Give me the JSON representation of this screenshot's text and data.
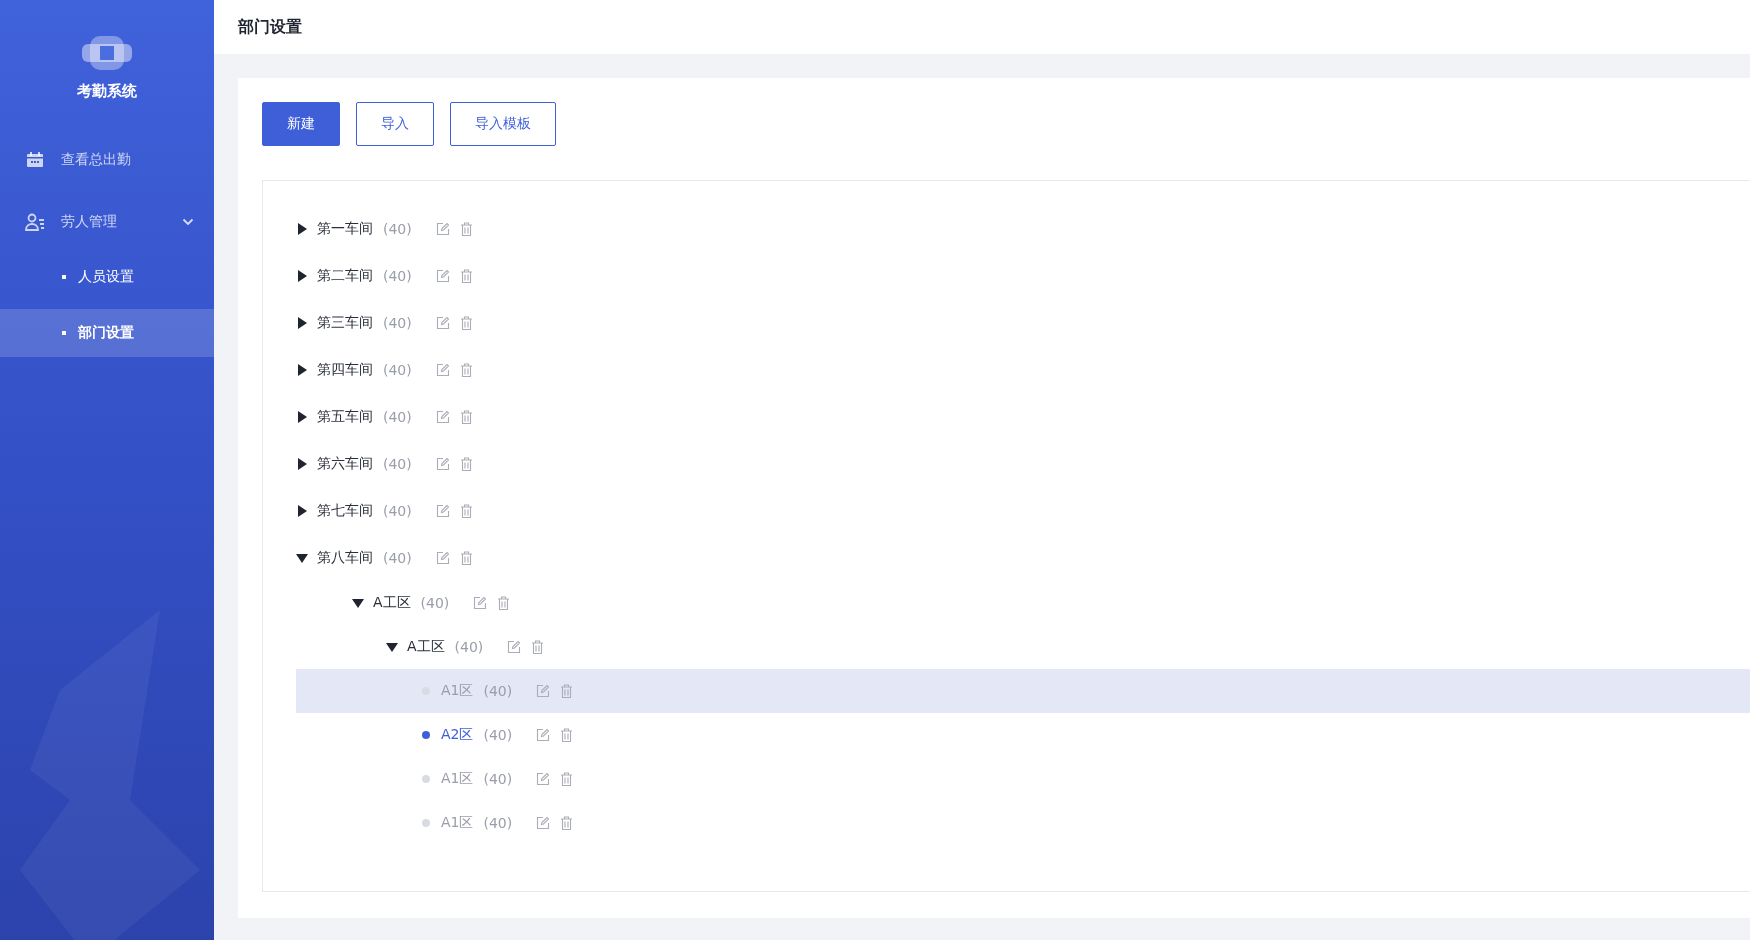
{
  "sidebar": {
    "app_name": "考勤系统",
    "menu": [
      {
        "label": "查看总出勤",
        "kind": "calendar"
      },
      {
        "label": "劳人管理",
        "kind": "people",
        "expanded": true,
        "children": [
          {
            "label": "人员设置",
            "selected": false
          },
          {
            "label": "部门设置",
            "selected": true
          }
        ]
      }
    ]
  },
  "header": {
    "title": "部门设置"
  },
  "buttons": [
    {
      "label": "新建",
      "kind": "primary"
    },
    {
      "label": "导入",
      "kind": "outline"
    },
    {
      "label": "导入模板",
      "kind": "outline"
    }
  ],
  "tree": [
    {
      "label": "第一车间",
      "count": "(40)",
      "expanded": false
    },
    {
      "label": "第二车间",
      "count": "(40)",
      "expanded": false
    },
    {
      "label": "第三车间",
      "count": "(40)",
      "expanded": false
    },
    {
      "label": "第四车间",
      "count": "(40)",
      "expanded": false
    },
    {
      "label": "第五车间",
      "count": "(40)",
      "expanded": false
    },
    {
      "label": "第六车间",
      "count": "(40)",
      "expanded": false
    },
    {
      "label": "第七车间",
      "count": "(40)",
      "expanded": false
    },
    {
      "label": "第八车间",
      "count": "(40)",
      "expanded": true,
      "children": [
        {
          "label": "A工区",
          "count": "(40)",
          "expanded": true,
          "children": [
            {
              "label": "A工区",
              "count": "(40)",
              "expanded": true,
              "children": [
                {
                  "label": "A1区",
                  "count": "(40)",
                  "kind": "leaf",
                  "selected": false,
                  "hovered": true
                },
                {
                  "label": "A2区",
                  "count": "(40)",
                  "kind": "leaf",
                  "selected": true,
                  "hovered": false
                },
                {
                  "label": "A1区",
                  "count": "(40)",
                  "kind": "leaf",
                  "selected": false,
                  "hovered": false
                },
                {
                  "label": "A1区",
                  "count": "(40)",
                  "kind": "leaf",
                  "selected": false,
                  "hovered": false
                }
              ]
            }
          ]
        }
      ]
    }
  ]
}
